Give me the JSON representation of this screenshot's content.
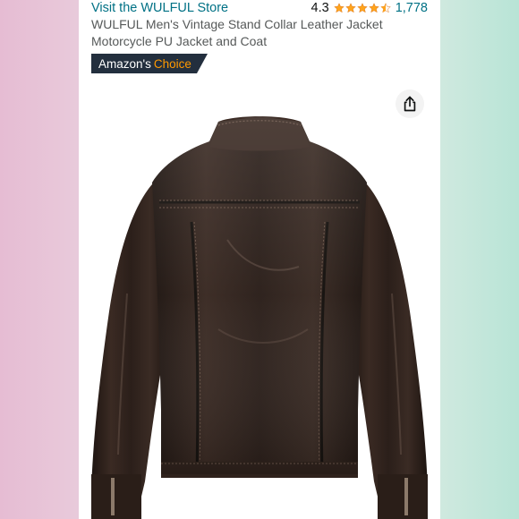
{
  "header": {
    "store_link": "Visit the WULFUL Store",
    "rating_value": "4.3",
    "rating_stars": 4.3,
    "rating_count": "1,778",
    "product_title": "WULFUL Men's Vintage Stand Collar Leather Jacket Motorcycle PU Jacket and Coat",
    "badge_prefix": "Amazon's",
    "badge_accent": "Choice"
  },
  "icons": {
    "share": "share-icon",
    "star": "star-icon",
    "product_image": "leather-jacket-back-view"
  },
  "colors": {
    "link": "#007185",
    "star": "#ffa41c",
    "badge_bg": "#232f3e",
    "badge_accent": "#ff9900",
    "jacket_leather": "#2a1e1a"
  }
}
